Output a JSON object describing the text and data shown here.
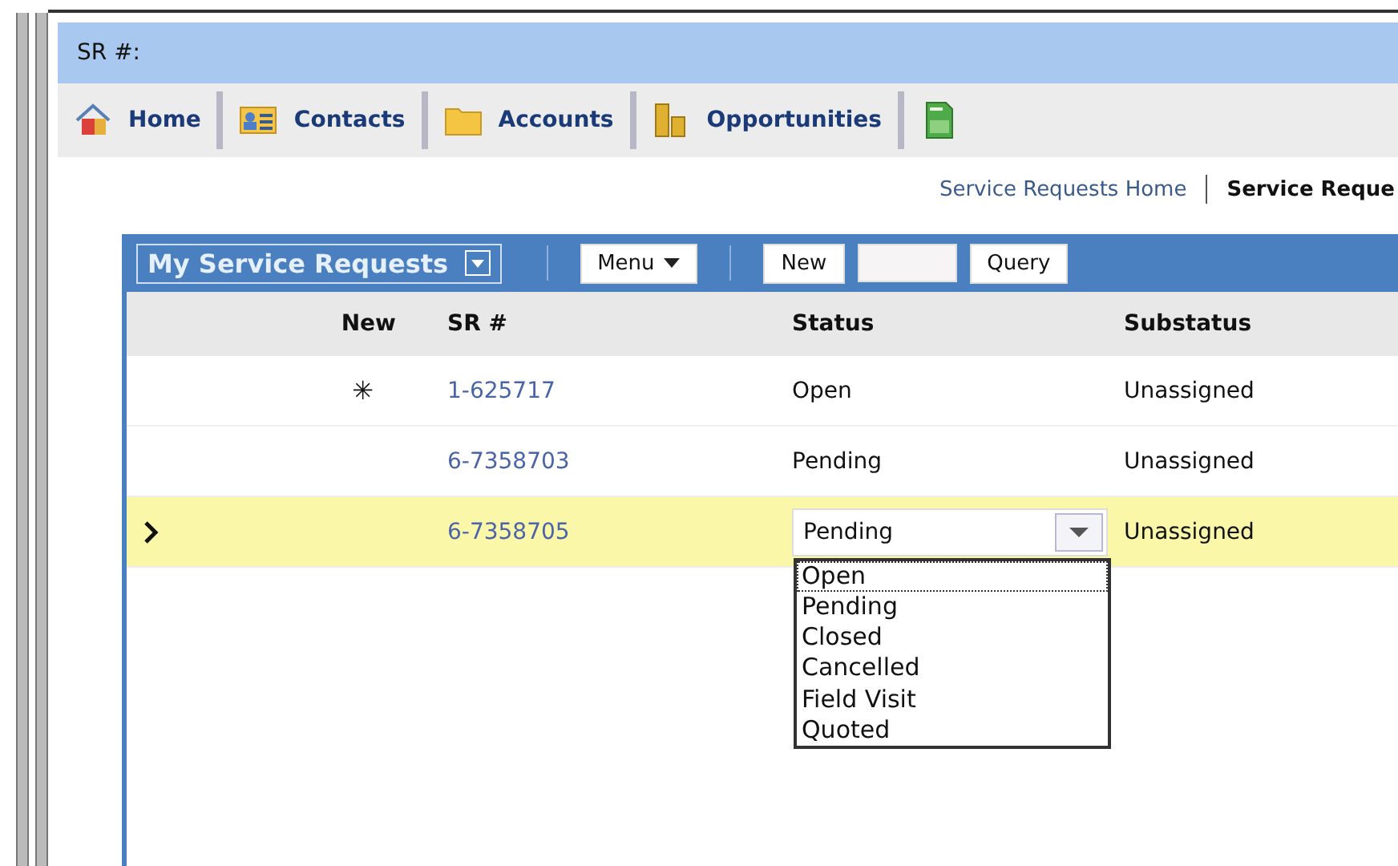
{
  "header": {
    "label": "SR #:"
  },
  "tabs": [
    {
      "label": "Home",
      "selected": false
    },
    {
      "label": "Contacts",
      "selected": false
    },
    {
      "label": "Accounts",
      "selected": false
    },
    {
      "label": "Opportunities",
      "selected": false
    },
    {
      "selected": false
    }
  ],
  "subnav": [
    {
      "label": "Service Requests Home",
      "selected": false
    },
    {
      "label": "Service Reque",
      "selected": true
    }
  ],
  "toolbar": {
    "view": "My Service Requests",
    "buttons": [
      {
        "label": "Menu",
        "kind": "menu",
        "disabled": false
      },
      {
        "label": "New",
        "kind": "plain",
        "disabled": false
      },
      {
        "kind": "plain",
        "disabled": true
      },
      {
        "label": "Query",
        "kind": "plain",
        "disabled": false
      }
    ]
  },
  "table": {
    "columns": [
      "New",
      "SR #",
      "Status",
      "Substatus"
    ],
    "rows": [
      {
        "new": "✳",
        "sr": "1-625717",
        "status": "Open",
        "substatus": "Unassigned",
        "selected": false
      },
      {
        "sr": "6-7358703",
        "status": "Pending",
        "substatus": "Unassigned",
        "selected": false
      },
      {
        "sr": "6-7358705",
        "status": "Pending",
        "substatus": "Unassigned",
        "selected": true
      }
    ]
  },
  "status_dropdown": {
    "options": [
      {
        "label": "Open",
        "selected": true
      },
      {
        "label": "Pending",
        "selected": false
      },
      {
        "label": "Closed",
        "selected": false
      },
      {
        "label": "Cancelled",
        "selected": false
      },
      {
        "label": "Field Visit",
        "selected": false
      },
      {
        "label": "Quoted",
        "selected": false
      }
    ]
  }
}
